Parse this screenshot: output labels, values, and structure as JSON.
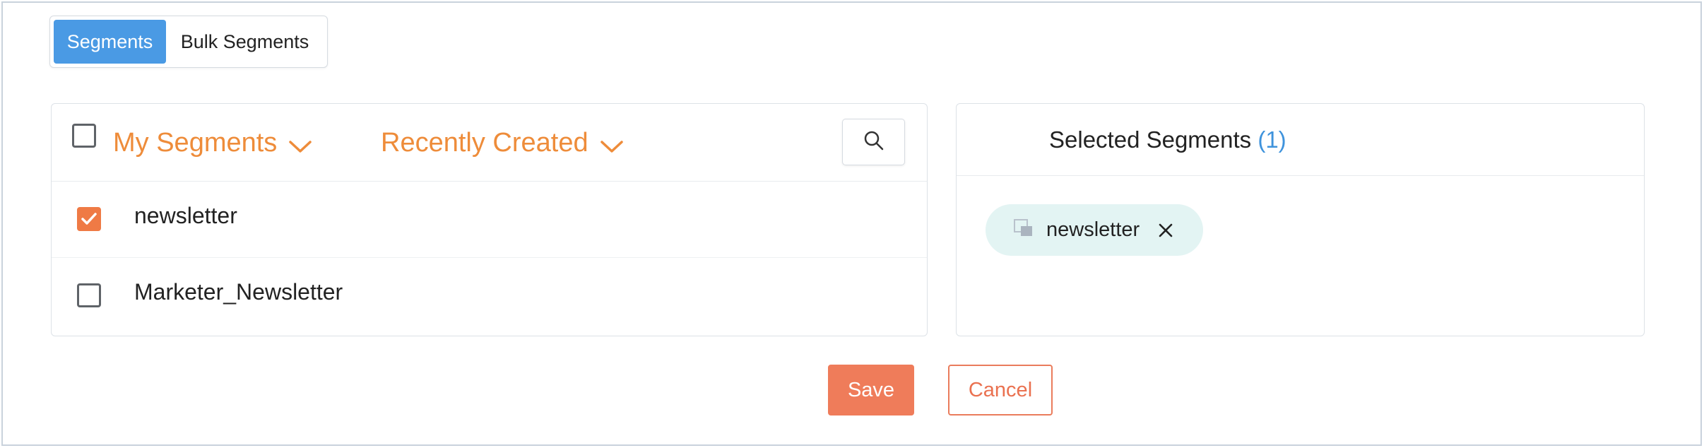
{
  "tabs": [
    {
      "label": "Segments",
      "active": true
    },
    {
      "label": "Bulk Segments",
      "active": false
    }
  ],
  "left_panel": {
    "select_all_checked": false,
    "filter_owner": {
      "label": "My Segments",
      "icon": "chevron-down-icon"
    },
    "filter_sort": {
      "label": "Recently Created",
      "icon": "chevron-down-icon"
    },
    "search_icon": "search-icon",
    "rows": [
      {
        "label": "newsletter",
        "checked": true
      },
      {
        "label": "Marketer_Newsletter",
        "checked": false
      }
    ]
  },
  "right_panel": {
    "title": "Selected Segments",
    "count": "(1)",
    "chips": [
      {
        "label": "newsletter",
        "icon": "segment-icon",
        "remove_icon": "close-icon"
      }
    ]
  },
  "actions": {
    "save_label": "Save",
    "cancel_label": "Cancel"
  },
  "colors": {
    "accent_orange": "#ee8c3a",
    "primary_button": "#ef7c5a",
    "tab_active": "#4a9ae4",
    "count_blue": "#3f93dc",
    "chip_bg": "#e3f4f3"
  }
}
